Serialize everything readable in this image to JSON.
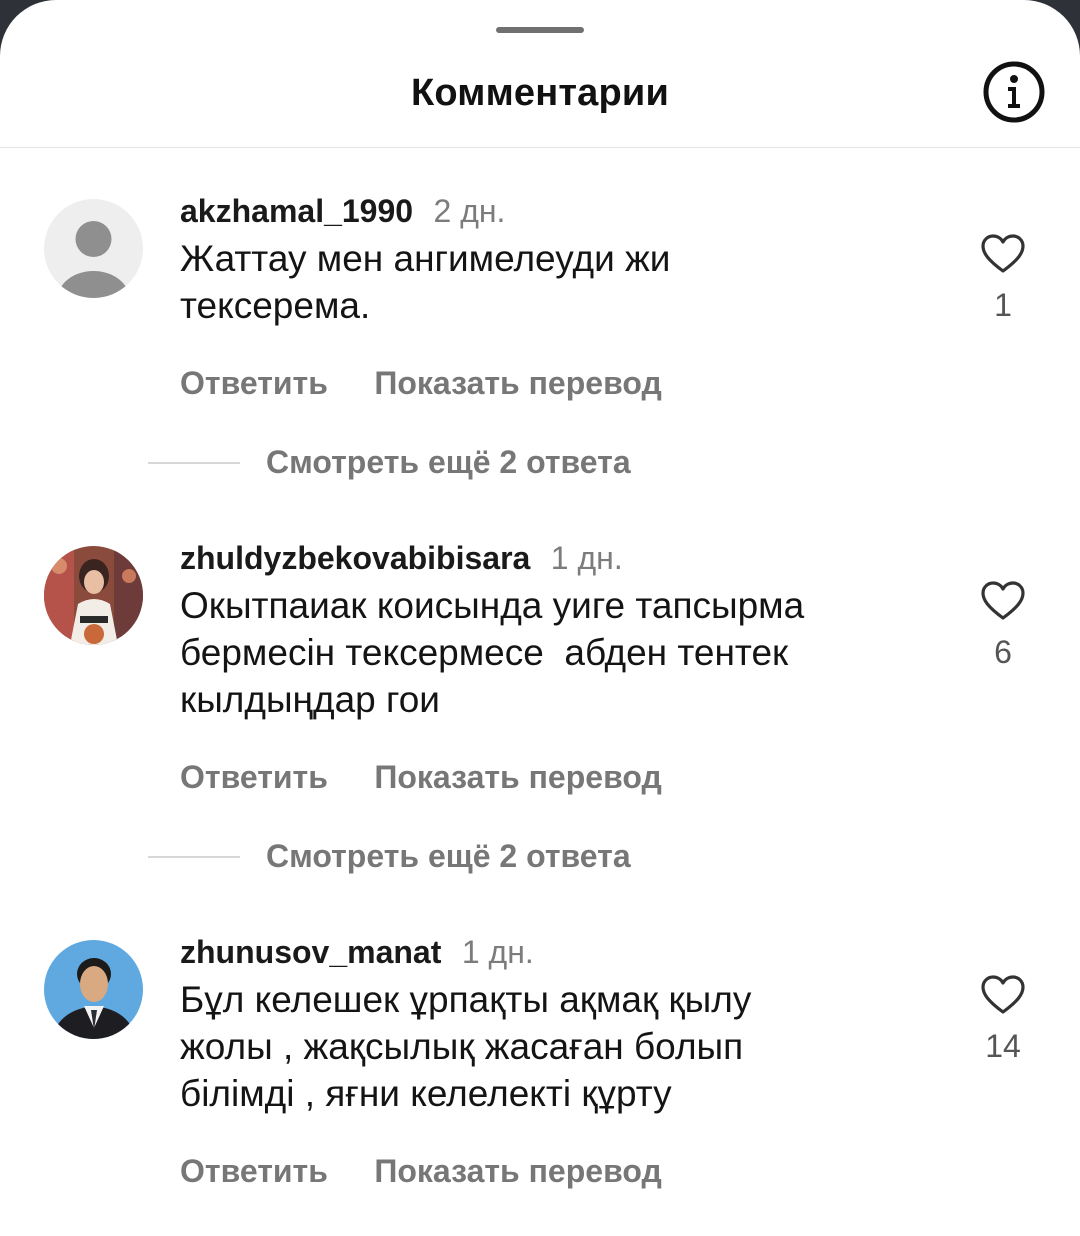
{
  "sheet": {
    "title": "Комментарии",
    "info_icon": "info-circle-icon"
  },
  "comments": [
    {
      "username": "akzhamal_1990",
      "time": "2 дн.",
      "text": "Жаттау мен ангимелеуди жи\nтексерема.",
      "reply_label": "Ответить",
      "translate_label": "Показать перевод",
      "likes": "1",
      "view_replies_label": "Смотреть ещё 2 ответа",
      "avatar_icon": "default-user-avatar-icon"
    },
    {
      "username": "zhuldyzbekovabibisara",
      "time": "1 дн.",
      "text": "Окытпаиак коисында уиге тапсырма\nбермесін тексермесе  абден тентек\nкылдыңдар гои",
      "reply_label": "Ответить",
      "translate_label": "Показать перевод",
      "likes": "6",
      "view_replies_label": "Смотреть ещё 2 ответа",
      "avatar_icon": "profile-photo-avatar"
    },
    {
      "username": "zhunusov_manat",
      "time": "1 дн.",
      "text": "Бұл келешек ұрпақты ақмақ қылу\nжолы , жақсылық жасаған болып\nбілімді , яғни келелекті құрту",
      "reply_label": "Ответить",
      "translate_label": "Показать перевод",
      "likes": "14",
      "avatar_icon": "profile-photo-avatar"
    }
  ],
  "colors": {
    "text_primary": "#111111",
    "text_secondary": "#777777",
    "background": "#ffffff"
  }
}
